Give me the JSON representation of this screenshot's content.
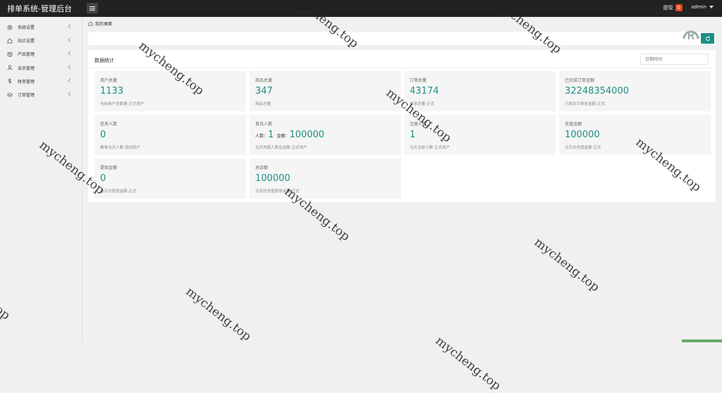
{
  "header": {
    "app_title": "排单系统-管理后台",
    "notice_label": "提现",
    "notice_count": "0",
    "user": "admin"
  },
  "sidebar": {
    "items": [
      {
        "label": "系统设置",
        "icon": "gear-icon"
      },
      {
        "label": "站点设置",
        "icon": "home-icon"
      },
      {
        "label": "产品管理",
        "icon": "box-icon"
      },
      {
        "label": "会员管理",
        "icon": "user-icon"
      },
      {
        "label": "财务管理",
        "icon": "dollar-icon"
      },
      {
        "label": "订单管理",
        "icon": "layers-icon"
      }
    ]
  },
  "breadcrumb": {
    "home": "我的桌面"
  },
  "panel": {
    "title": "数据统计",
    "date_placeholder": "日期时间"
  },
  "cards": [
    {
      "title": "用户总量",
      "value": "1133",
      "note": "当前用户总数量-正式用户"
    },
    {
      "title": "商品总量",
      "value": "347",
      "note": "商品总量"
    },
    {
      "title": "订单总量",
      "value": "43174",
      "note": "订单总量-正式"
    },
    {
      "title": "已完成订单金额",
      "value": "32248354000",
      "note": "已成交订单总金额-正式"
    },
    {
      "title": "任务人数",
      "value": "0",
      "note": "做单当天人数-测试用户"
    },
    {
      "title": "首充人数",
      "people_label": "人数：",
      "value": "1",
      "amount_label": "金额：",
      "amount": "100000",
      "note": "当天充值人数及金额-正式用户"
    },
    {
      "title": "注册人数",
      "value": "1",
      "note": "当天注册人数-正式用户"
    },
    {
      "title": "充值金额",
      "value": "100000",
      "note": "当天总充值金额-正式"
    },
    {
      "title": "提现金额",
      "value": "0",
      "note": "当天总提现金额-正式"
    },
    {
      "title": "总余额",
      "value": "100000",
      "note": "当天的充值提现余额-正式"
    }
  ],
  "watermark": "mycheng.top",
  "colors": {
    "accent": "#1e8f84",
    "topbar": "#222222",
    "badge": "#e64a19"
  }
}
